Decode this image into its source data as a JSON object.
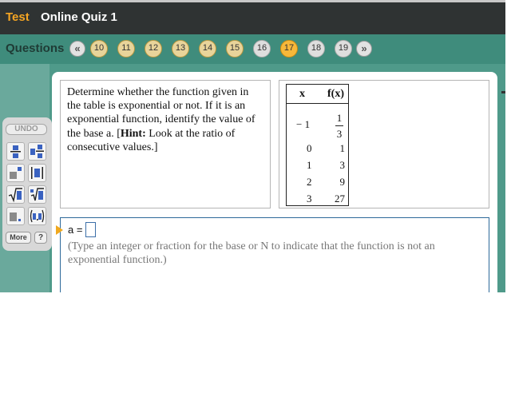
{
  "header": {
    "mode": "Test",
    "title": "Online Quiz 1"
  },
  "questions_bar": {
    "label": "Questions",
    "prev_icon": "double-chevron-left-icon",
    "next_icon": "double-chevron-right-icon",
    "prev_glyph": "«",
    "next_glyph": "»",
    "items": [
      {
        "label": "10",
        "state": "answered"
      },
      {
        "label": "11",
        "state": "answered"
      },
      {
        "label": "12",
        "state": "answered"
      },
      {
        "label": "13",
        "state": "answered"
      },
      {
        "label": "14",
        "state": "answered"
      },
      {
        "label": "15",
        "state": "answered"
      },
      {
        "label": "16",
        "state": "unanswered"
      },
      {
        "label": "17",
        "state": "current"
      },
      {
        "label": "18",
        "state": "unanswered"
      },
      {
        "label": "19",
        "state": "unanswered"
      }
    ]
  },
  "toolbox": {
    "undo_label": "UNDO",
    "tools": [
      "fraction-icon",
      "mixed-number-icon",
      "exponent-icon",
      "absolute-value-icon",
      "square-root-icon",
      "nth-root-icon",
      "decimal-icon",
      "interval-icon"
    ],
    "more_label": "More",
    "help_label": "?"
  },
  "question": {
    "text_1": "Determine whether the function given in the table is exponential or not.  If it is an exponential function, identify the value of the base a.  [",
    "hint_bold": "Hint:",
    "text_2": "  Look at the ratio of consecutive values.]"
  },
  "table": {
    "col_x": "x",
    "col_fx": "f(x)",
    "rows": [
      {
        "x": "− 1",
        "fx_num": "1",
        "fx_den": "3"
      },
      {
        "x": "0",
        "fx": "1"
      },
      {
        "x": "1",
        "fx": "3"
      },
      {
        "x": "2",
        "fx": "9"
      },
      {
        "x": "3",
        "fx": "27"
      }
    ]
  },
  "answer": {
    "label": "a =",
    "value": "",
    "hint": "(Type an integer or fraction for the base or N to indicate that the function is not an exponential function.)"
  },
  "colors": {
    "accent_orange": "#f6a623",
    "header_bg": "#2f3333",
    "teal": "#4f9a8a",
    "answer_border": "#2e6a9a"
  }
}
